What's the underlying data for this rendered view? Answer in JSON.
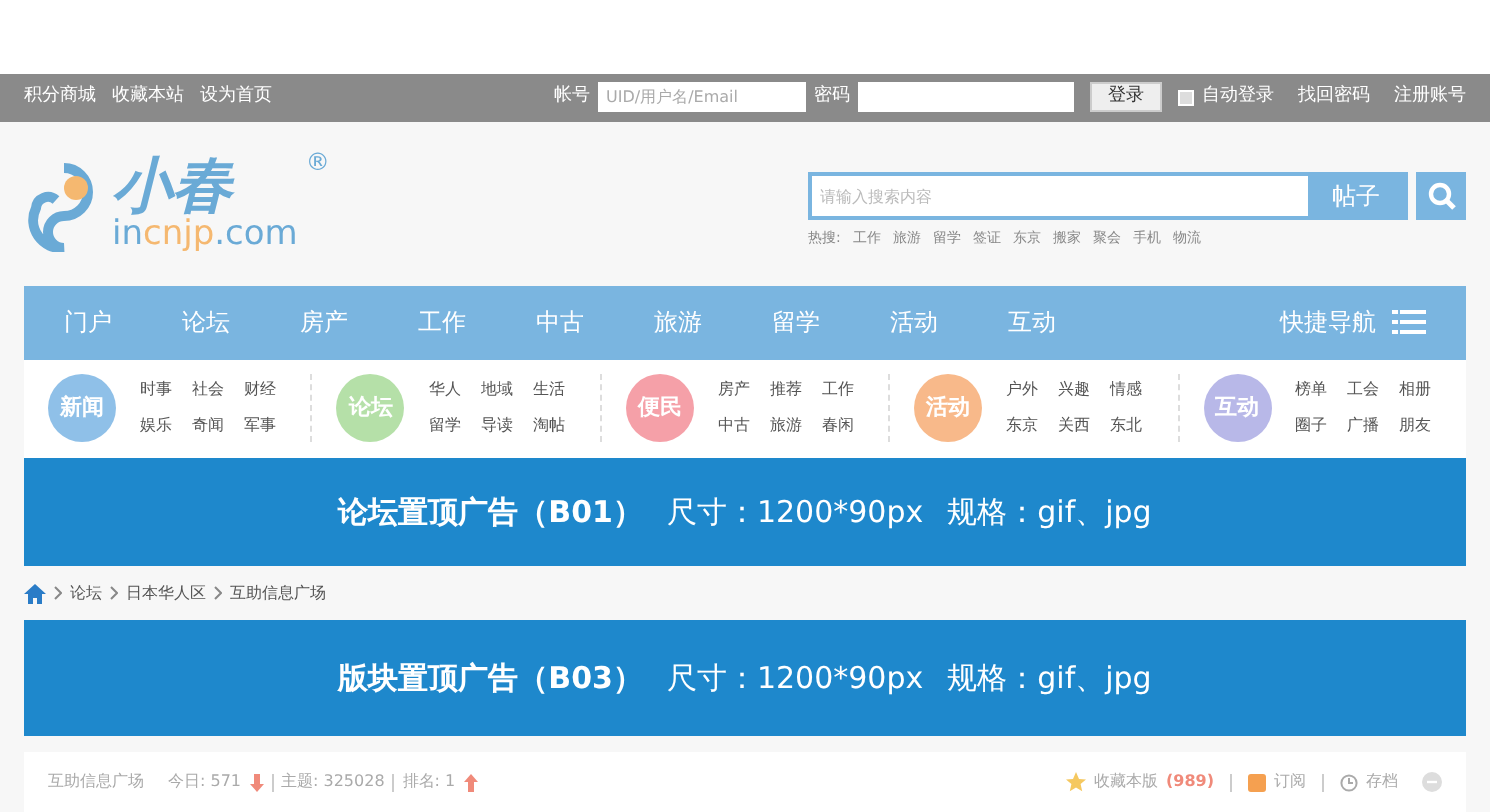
{
  "topbar": {
    "links": [
      "积分商城",
      "收藏本站",
      "设为首页"
    ],
    "account_label": "帐号",
    "account_placeholder": "UID/用户名/Email",
    "password_label": "密码",
    "login_button": "登录",
    "remember": {
      "label": "自动登录",
      "checked": false
    },
    "right_links": [
      "找回密码",
      "注册账号"
    ]
  },
  "logo": {
    "name": "小春",
    "domain_parts": [
      "in",
      "cnjp",
      ".com"
    ],
    "mark": "®"
  },
  "search": {
    "placeholder": "请输入搜索内容",
    "type_button": "帖子",
    "hot_label": "热搜:",
    "hot": [
      "工作",
      "旅游",
      "留学",
      "签证",
      "东京",
      "搬家",
      "聚会",
      "手机",
      "物流"
    ]
  },
  "nav": {
    "items": [
      "门户",
      "论坛",
      "房产",
      "工作",
      "中古",
      "旅游",
      "留学",
      "活动",
      "互动"
    ],
    "quick": "快捷导航"
  },
  "categories": [
    {
      "name": "新闻",
      "color": "#8fc0e8",
      "links": [
        "时事",
        "社会",
        "财经",
        "娱乐",
        "奇闻",
        "军事"
      ]
    },
    {
      "name": "论坛",
      "color": "#b5e0a8",
      "links": [
        "华人",
        "地域",
        "生活",
        "留学",
        "导读",
        "淘帖"
      ]
    },
    {
      "name": "便民",
      "color": "#f5a0a8",
      "links": [
        "房产",
        "推荐",
        "工作",
        "中古",
        "旅游",
        "春闲"
      ]
    },
    {
      "name": "活动",
      "color": "#f8b98a",
      "links": [
        "户外",
        "兴趣",
        "情感",
        "东京",
        "关西",
        "东北"
      ]
    },
    {
      "name": "互动",
      "color": "#b8b8e8",
      "links": [
        "榜单",
        "工会",
        "相册",
        "圈子",
        "广播",
        "朋友"
      ]
    }
  ],
  "ad_top": {
    "code": "论坛置顶广告（B01）",
    "size": "尺寸：1200*90px",
    "format": "规格：gif、jpg"
  },
  "breadcrumb": [
    "论坛",
    "日本华人区",
    "互助信息广场"
  ],
  "ad_board": {
    "code": "版块置顶广告（B03）",
    "size": "尺寸：1200*90px",
    "format": "规格：gif、jpg"
  },
  "forum_bar": {
    "name": "互助信息广场",
    "today": "今日: 571",
    "topics": "主题: 325028",
    "rank": "排名: 1",
    "favorite": "收藏本版",
    "favorite_count": "(989)",
    "subscribe": "订阅",
    "archive": "存档"
  }
}
